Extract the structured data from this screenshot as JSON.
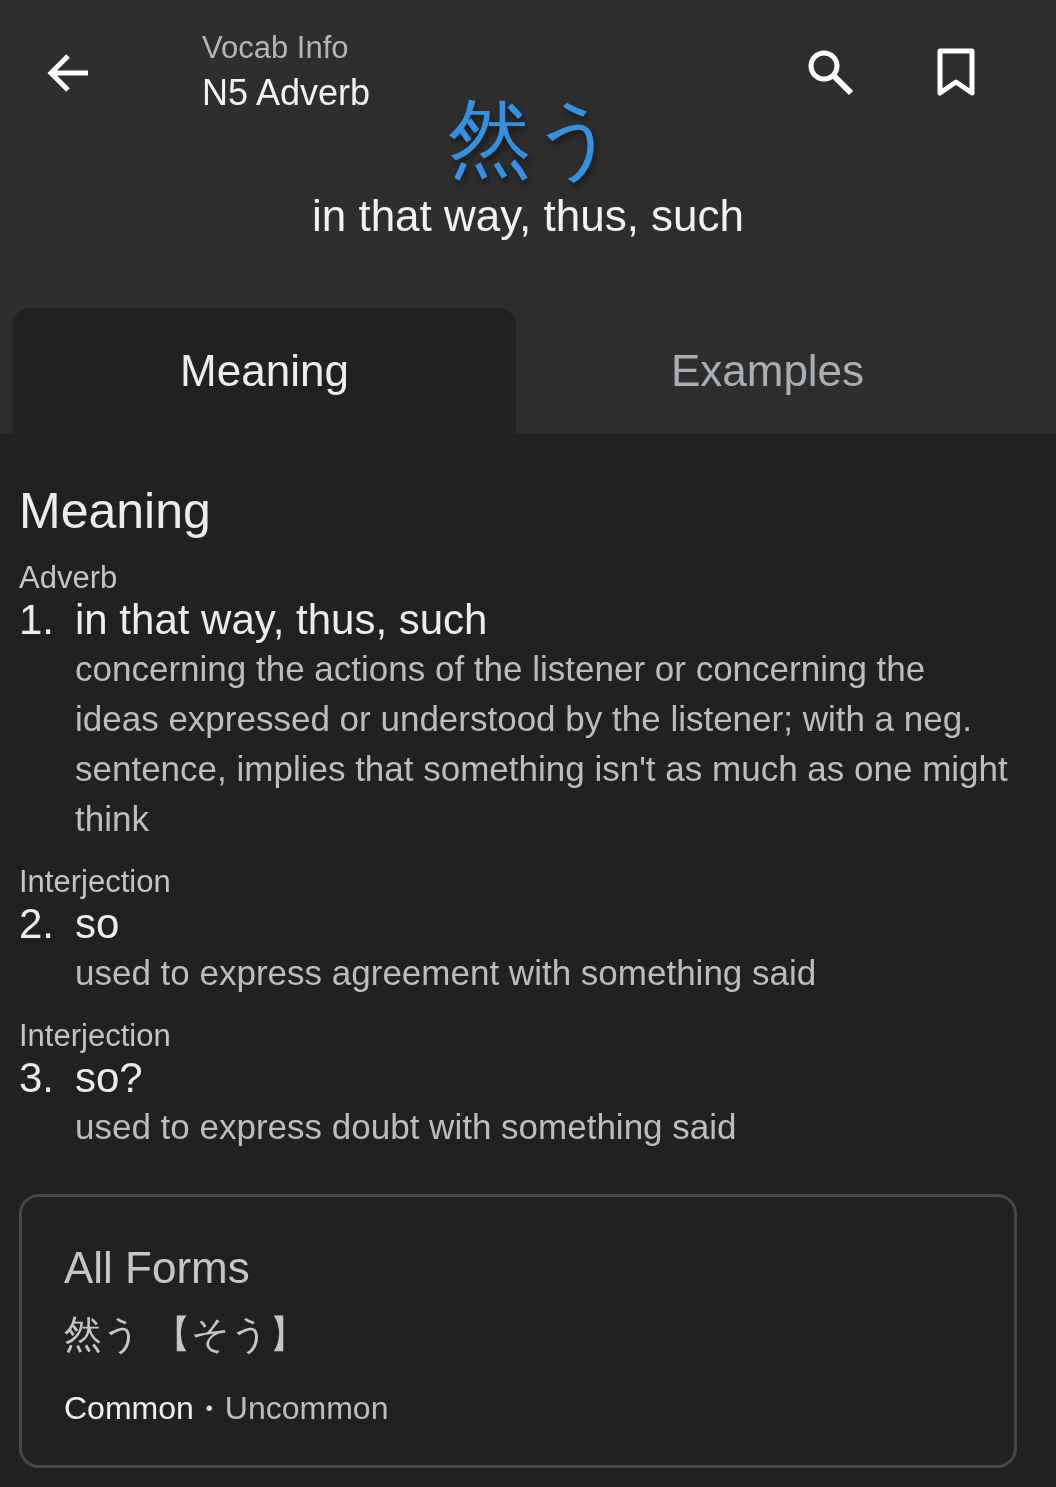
{
  "header": {
    "subtitle": "Vocab Info",
    "title": "N5 Adverb"
  },
  "word": {
    "text": "然う",
    "gloss": "in that way, thus, such"
  },
  "tabs": [
    {
      "label": "Meaning",
      "selected": true
    },
    {
      "label": "Examples",
      "selected": false
    }
  ],
  "meaning": {
    "heading": "Meaning",
    "senses": [
      {
        "pos": "Adverb",
        "number": "1.",
        "gloss": "in that way, thus, such",
        "note": "concerning the actions of the listener or concerning the ideas expressed or understood by the listener; with a neg. sentence, implies that something isn't as much as one might think"
      },
      {
        "pos": "Interjection",
        "number": "2.",
        "gloss": "so",
        "note": "used to express agreement with something said"
      },
      {
        "pos": "Interjection",
        "number": "3.",
        "gloss": "so?",
        "note": "used to express doubt with something said"
      }
    ]
  },
  "all_forms": {
    "heading": "All Forms",
    "forms": [
      "然う 【そう】"
    ],
    "separator": "•",
    "legend": [
      {
        "label": "Common",
        "kind": "common"
      },
      {
        "label": "Uncommon",
        "kind": "uncommon"
      }
    ]
  }
}
